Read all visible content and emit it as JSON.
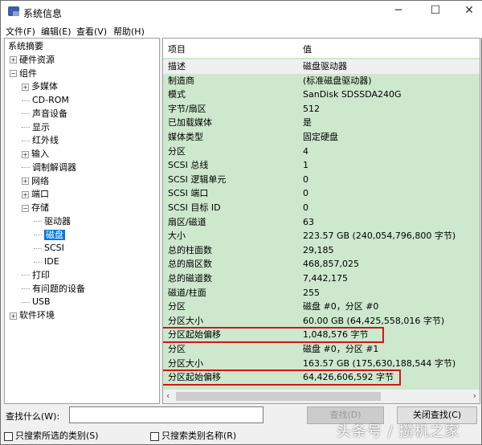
{
  "window": {
    "title": "系统信息",
    "minimize": "─",
    "maximize": "☐",
    "close": "✕"
  },
  "menu": [
    "文件(F)",
    "编辑(E)",
    "查看(V)",
    "帮助(H)"
  ],
  "tree": [
    {
      "label": "系统摘要",
      "level": 0,
      "exp": ""
    },
    {
      "label": "硬件资源",
      "level": 1,
      "exp": "+"
    },
    {
      "label": "组件",
      "level": 1,
      "exp": "-"
    },
    {
      "label": "多媒体",
      "level": 2,
      "exp": "+"
    },
    {
      "label": "CD-ROM",
      "level": 2,
      "exp": ""
    },
    {
      "label": "声音设备",
      "level": 2,
      "exp": ""
    },
    {
      "label": "显示",
      "level": 2,
      "exp": ""
    },
    {
      "label": "红外线",
      "level": 2,
      "exp": ""
    },
    {
      "label": "输入",
      "level": 2,
      "exp": "+"
    },
    {
      "label": "调制解调器",
      "level": 2,
      "exp": ""
    },
    {
      "label": "网络",
      "level": 2,
      "exp": "+"
    },
    {
      "label": "端口",
      "level": 2,
      "exp": "+"
    },
    {
      "label": "存储",
      "level": 2,
      "exp": "-"
    },
    {
      "label": "驱动器",
      "level": 3,
      "exp": ""
    },
    {
      "label": "磁盘",
      "level": 3,
      "exp": "",
      "selected": true
    },
    {
      "label": "SCSI",
      "level": 3,
      "exp": ""
    },
    {
      "label": "IDE",
      "level": 3,
      "exp": ""
    },
    {
      "label": "打印",
      "level": 2,
      "exp": ""
    },
    {
      "label": "有问题的设备",
      "level": 2,
      "exp": ""
    },
    {
      "label": "USB",
      "level": 2,
      "exp": ""
    },
    {
      "label": "软件环境",
      "level": 1,
      "exp": "+"
    }
  ],
  "table": {
    "headers": [
      "项目",
      "值"
    ],
    "rows": [
      [
        "描述",
        "磁盘驱动器"
      ],
      [
        "制造商",
        "(标准磁盘驱动器)"
      ],
      [
        "模式",
        "SanDisk SDSSDA240G"
      ],
      [
        "字节/扇区",
        "512"
      ],
      [
        "已加载媒体",
        "是"
      ],
      [
        "媒体类型",
        "固定硬盘"
      ],
      [
        "分区",
        "4"
      ],
      [
        "SCSI 总线",
        "1"
      ],
      [
        "SCSI 逻辑单元",
        "0"
      ],
      [
        "SCSI 端口",
        "0"
      ],
      [
        "SCSI 目标 ID",
        "0"
      ],
      [
        "扇区/磁道",
        "63"
      ],
      [
        "大小",
        "223.57 GB (240,054,796,800 字节)"
      ],
      [
        "总的柱面数",
        "29,185"
      ],
      [
        "总的扇区数",
        "468,857,025"
      ],
      [
        "总的磁道数",
        "7,442,175"
      ],
      [
        "磁道/柱面",
        "255"
      ],
      [
        "分区",
        "磁盘 #0，分区 #0"
      ],
      [
        "分区大小",
        "60.00 GB (64,425,558,016 字节)"
      ],
      [
        "分区起始偏移",
        "1,048,576 字节"
      ],
      [
        "分区",
        "磁盘 #0，分区 #1"
      ],
      [
        "分区大小",
        "163.57 GB (175,630,188,544 字节)"
      ],
      [
        "分区起始偏移",
        "64,426,606,592 字节"
      ]
    ],
    "highlighted_rows": [
      19,
      22
    ],
    "highlight_color": "#d4141c"
  },
  "find": {
    "label": "查找什么(W):",
    "value": "",
    "find_button": "查找(D)",
    "close_button": "关闭查找(C)",
    "cb1": "只搜索所选的类别(S)",
    "cb2": "只搜索类别名称(R)"
  },
  "watermark": "头条号 / 攒机之家"
}
